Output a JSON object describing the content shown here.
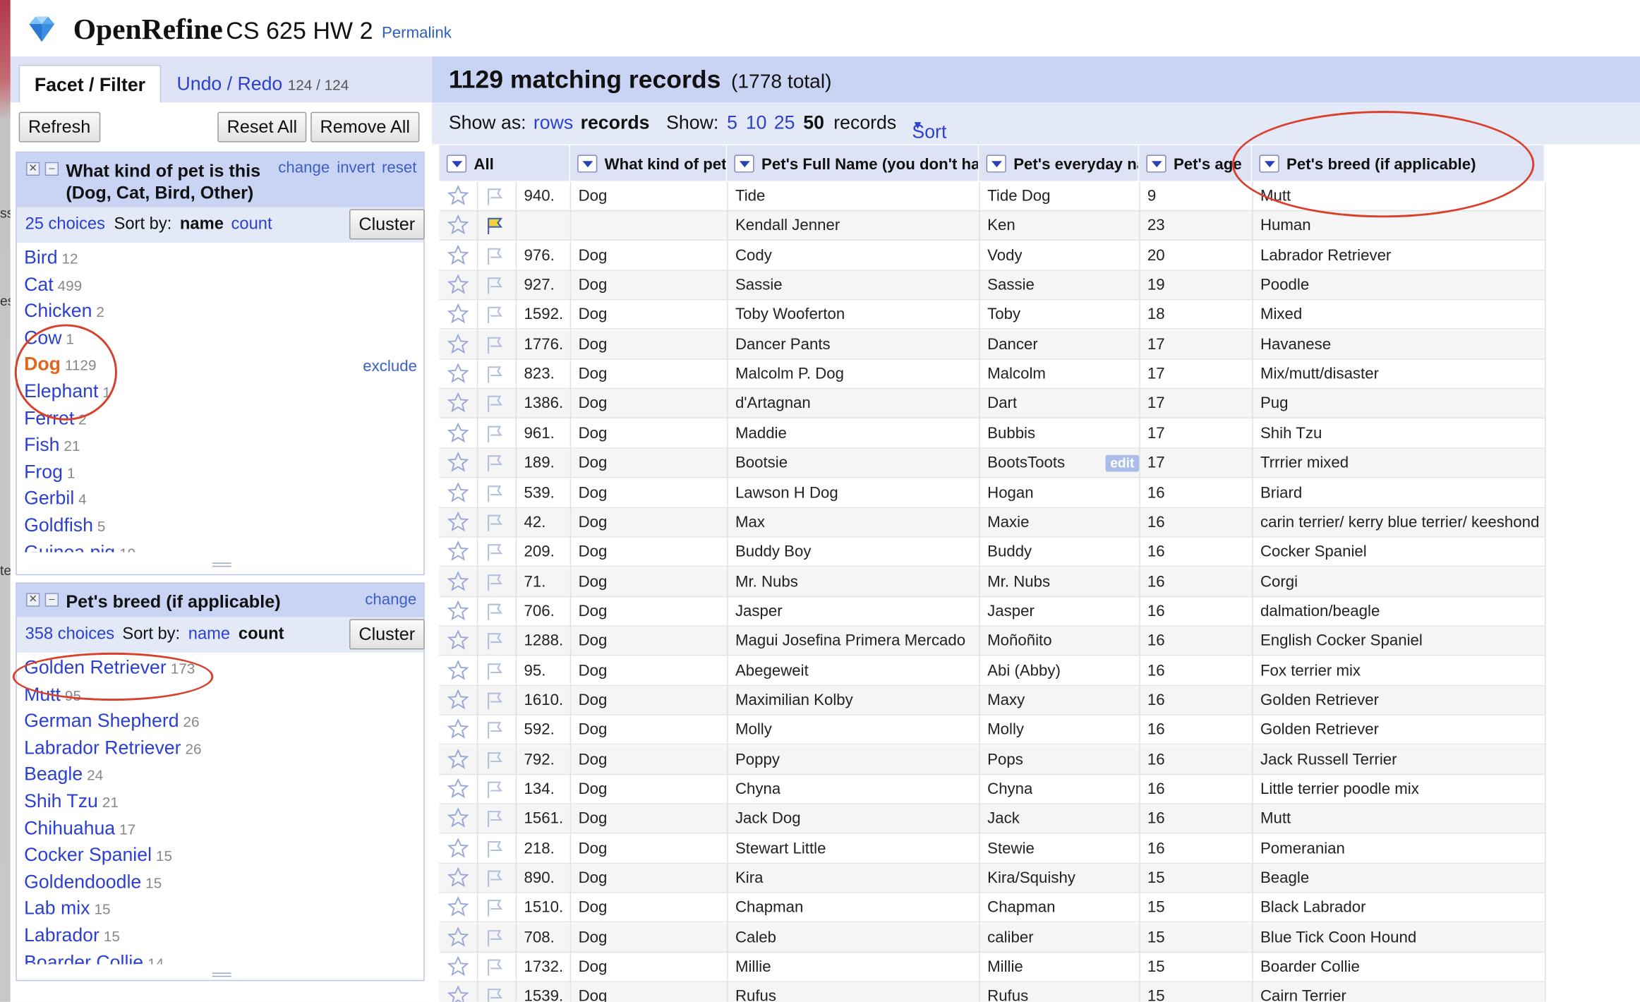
{
  "header": {
    "app_name": "OpenRefine",
    "project_name": "CS 625 HW 2",
    "permalink": "Permalink"
  },
  "left_edge": {
    "chars": [
      "ss",
      "es",
      "te"
    ]
  },
  "left_panel": {
    "tabs": {
      "facet": "Facet / Filter",
      "undo": "Undo / Redo",
      "undo_count": "124 / 124"
    },
    "buttons": {
      "refresh": "Refresh",
      "reset_all": "Reset All",
      "remove_all": "Remove All"
    },
    "facet1": {
      "title_line1": "What kind of pet is this",
      "title_line2": "(Dog, Cat, Bird, Other)",
      "controls": {
        "change": "change",
        "invert": "invert",
        "reset": "reset"
      },
      "choices_count": "25 choices",
      "sort_by": "Sort by:",
      "sort_name": "name",
      "sort_count": "count",
      "cluster": "Cluster",
      "exclude": "exclude",
      "choices": [
        {
          "label": "Bird",
          "count": "12"
        },
        {
          "label": "Cat",
          "count": "499"
        },
        {
          "label": "Chicken",
          "count": "2"
        },
        {
          "label": "Cow",
          "count": "1"
        },
        {
          "label": "Dog",
          "count": "1129"
        },
        {
          "label": "Elephant",
          "count": "1"
        },
        {
          "label": "Ferret",
          "count": "2"
        },
        {
          "label": "Fish",
          "count": "21"
        },
        {
          "label": "Frog",
          "count": "1"
        },
        {
          "label": "Gerbil",
          "count": "4"
        },
        {
          "label": "Goldfish",
          "count": "5"
        },
        {
          "label": "Guinea pig",
          "count": "10"
        }
      ]
    },
    "facet2": {
      "title": "Pet's breed (if applicable)",
      "change": "change",
      "choices_count": "358 choices",
      "sort_by": "Sort by:",
      "sort_name": "name",
      "sort_count": "count",
      "cluster": "Cluster",
      "choices": [
        {
          "label": "Golden Retriever",
          "count": "173"
        },
        {
          "label": "Mutt",
          "count": "95"
        },
        {
          "label": "German Shepherd",
          "count": "26"
        },
        {
          "label": "Labrador Retriever",
          "count": "26"
        },
        {
          "label": "Beagle",
          "count": "24"
        },
        {
          "label": "Shih Tzu",
          "count": "21"
        },
        {
          "label": "Chihuahua",
          "count": "17"
        },
        {
          "label": "Cocker Spaniel",
          "count": "15"
        },
        {
          "label": "Goldendoodle",
          "count": "15"
        },
        {
          "label": "Lab mix",
          "count": "15"
        },
        {
          "label": "Labrador",
          "count": "15"
        },
        {
          "label": "Boarder Collie",
          "count": "14"
        }
      ]
    }
  },
  "summary": {
    "matching": "1129 matching records",
    "total": "(1778 total)"
  },
  "view": {
    "show_as": "Show as:",
    "rows": "rows",
    "records": "records",
    "show": "Show:",
    "sizes": [
      "5",
      "10",
      "25",
      "50"
    ],
    "records_suffix": "records",
    "sort": "Sort"
  },
  "columns": [
    "All",
    "What kind of pet",
    "Pet's Full Name (you don't ha",
    "Pet's everyday na",
    "Pet's age",
    "Pet's breed (if applicable)"
  ],
  "edit_badge": "edit",
  "rows": [
    {
      "idx": "940.",
      "kind": "Dog",
      "full": "Tide",
      "everyday": "Tide Dog",
      "age": "9",
      "breed": "Mutt"
    },
    {
      "idx": "",
      "kind": "",
      "full": "Kendall Jenner",
      "everyday": "Ken",
      "age": "23",
      "breed": "Human"
    },
    {
      "idx": "976.",
      "kind": "Dog",
      "full": "Cody",
      "everyday": "Vody",
      "age": "20",
      "breed": "Labrador Retriever"
    },
    {
      "idx": "927.",
      "kind": "Dog",
      "full": "Sassie",
      "everyday": "Sassie",
      "age": "19",
      "breed": "Poodle"
    },
    {
      "idx": "1592.",
      "kind": "Dog",
      "full": "Toby Wooferton",
      "everyday": "Toby",
      "age": "18",
      "breed": "Mixed"
    },
    {
      "idx": "1776.",
      "kind": "Dog",
      "full": "Dancer Pants",
      "everyday": "Dancer",
      "age": "17",
      "breed": "Havanese"
    },
    {
      "idx": "823.",
      "kind": "Dog",
      "full": "Malcolm P. Dog",
      "everyday": "Malcolm",
      "age": "17",
      "breed": "Mix/mutt/disaster"
    },
    {
      "idx": "1386.",
      "kind": "Dog",
      "full": "d'Artagnan",
      "everyday": "Dart",
      "age": "17",
      "breed": "Pug"
    },
    {
      "idx": "961.",
      "kind": "Dog",
      "full": "Maddie",
      "everyday": "Bubbis",
      "age": "17",
      "breed": "Shih Tzu"
    },
    {
      "idx": "189.",
      "kind": "Dog",
      "full": "Bootsie",
      "everyday": "BootsToots",
      "age": "17",
      "breed": "Trrrier mixed"
    },
    {
      "idx": "539.",
      "kind": "Dog",
      "full": "Lawson H Dog",
      "everyday": "Hogan",
      "age": "16",
      "breed": "Briard"
    },
    {
      "idx": "42.",
      "kind": "Dog",
      "full": "Max",
      "everyday": "Maxie",
      "age": "16",
      "breed": "carin terrier/ kerry blue terrier/ keeshond"
    },
    {
      "idx": "209.",
      "kind": "Dog",
      "full": "Buddy Boy",
      "everyday": "Buddy",
      "age": "16",
      "breed": "Cocker Spaniel"
    },
    {
      "idx": "71.",
      "kind": "Dog",
      "full": "Mr. Nubs",
      "everyday": "Mr. Nubs",
      "age": "16",
      "breed": "Corgi"
    },
    {
      "idx": "706.",
      "kind": "Dog",
      "full": "Jasper",
      "everyday": "Jasper",
      "age": "16",
      "breed": "dalmation/beagle"
    },
    {
      "idx": "1288.",
      "kind": "Dog",
      "full": "Magui Josefina Primera Mercado",
      "everyday": "Moñoñito",
      "age": "16",
      "breed": "English Cocker Spaniel"
    },
    {
      "idx": "95.",
      "kind": "Dog",
      "full": "Abegeweit",
      "everyday": "Abi (Abby)",
      "age": "16",
      "breed": "Fox terrier mix"
    },
    {
      "idx": "1610.",
      "kind": "Dog",
      "full": "Maximilian Kolby",
      "everyday": "Maxy",
      "age": "16",
      "breed": "Golden Retriever"
    },
    {
      "idx": "592.",
      "kind": "Dog",
      "full": "Molly",
      "everyday": "Molly",
      "age": "16",
      "breed": "Golden Retriever"
    },
    {
      "idx": "792.",
      "kind": "Dog",
      "full": "Poppy",
      "everyday": "Pops",
      "age": "16",
      "breed": "Jack Russell Terrier"
    },
    {
      "idx": "134.",
      "kind": "Dog",
      "full": "Chyna",
      "everyday": "Chyna",
      "age": "16",
      "breed": "Little terrier poodle mix"
    },
    {
      "idx": "1561.",
      "kind": "Dog",
      "full": "Jack Dog",
      "everyday": "Jack",
      "age": "16",
      "breed": "Mutt"
    },
    {
      "idx": "218.",
      "kind": "Dog",
      "full": "Stewart Little",
      "everyday": "Stewie",
      "age": "16",
      "breed": "Pomeranian"
    },
    {
      "idx": "890.",
      "kind": "Dog",
      "full": "Kira",
      "everyday": "Kira/Squishy",
      "age": "15",
      "breed": "Beagle"
    },
    {
      "idx": "1510.",
      "kind": "Dog",
      "full": "Chapman",
      "everyday": "Chapman",
      "age": "15",
      "breed": "Black Labrador"
    },
    {
      "idx": "708.",
      "kind": "Dog",
      "full": "Caleb",
      "everyday": "caliber",
      "age": "15",
      "breed": "Blue Tick Coon Hound"
    },
    {
      "idx": "1732.",
      "kind": "Dog",
      "full": "Millie",
      "everyday": "Millie",
      "age": "15",
      "breed": "Boarder Collie"
    },
    {
      "idx": "1539.",
      "kind": "Dog",
      "full": "Rufus",
      "everyday": "Rufus",
      "age": "15",
      "breed": "Cairn Terrier"
    }
  ]
}
